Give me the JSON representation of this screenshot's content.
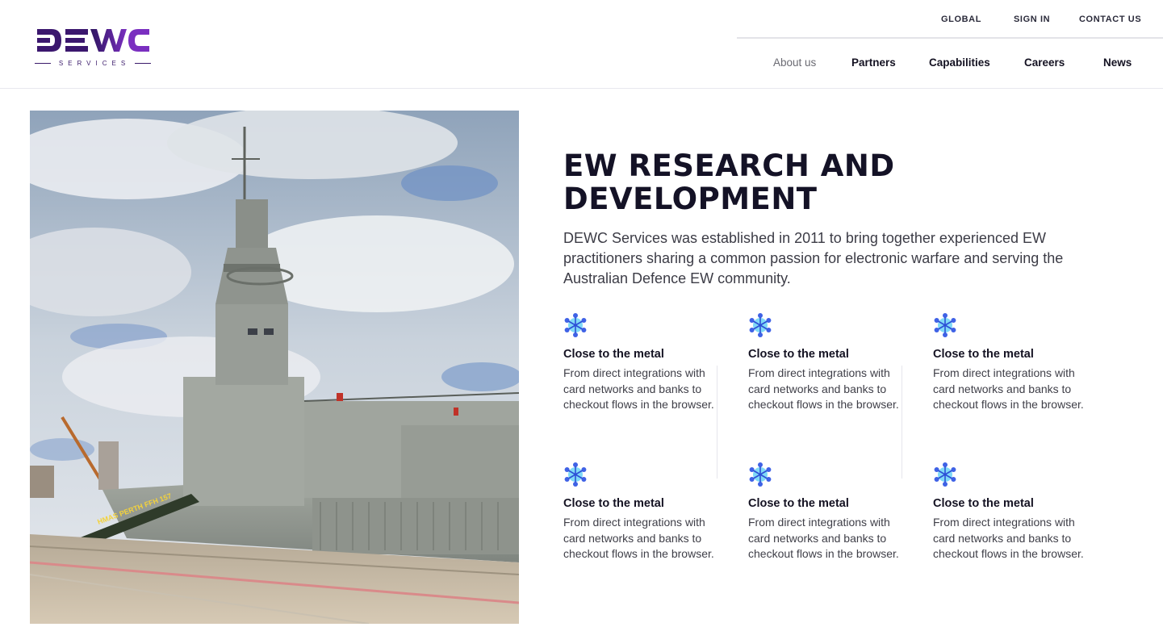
{
  "brand": {
    "logo_text": "DEWC",
    "logo_sub": "SERVICES",
    "color_primary": "#3b176e",
    "color_accent": "#7a2fc0"
  },
  "utility_nav": {
    "global": "GLOBAL",
    "sign_in": "SIGN IN",
    "contact": "CONTACT US"
  },
  "main_nav": {
    "about": "About us",
    "partners": "Partners",
    "capabilities": "Capabilities",
    "careers": "Careers",
    "news": "News"
  },
  "hero": {
    "title_line1": "EW RESEARCH AND",
    "title_line2": "DEVELOPMENT",
    "intro": "DEWC Services was established in 2011 to bring together experienced EW practitioners sharing a common passion for electronic warfare and serving the Australian Defence EW community.",
    "image_alt_icon": "warship-photo"
  },
  "features": [
    {
      "title": "Close to the metal",
      "body": "From direct integrations with card networks and banks to checkout flows in the browser."
    },
    {
      "title": "Close to the metal",
      "body": "From direct integrations with card networks and banks to checkout flows in the browser."
    },
    {
      "title": "Close to the metal",
      "body": "From direct integrations with card networks and banks to checkout flows in the browser."
    },
    {
      "title": "Close to the metal",
      "body": "From direct integrations with card networks and banks to checkout flows in the browser."
    },
    {
      "title": "Close to the metal",
      "body": "From direct integrations with card networks and banks to checkout flows in the browser."
    },
    {
      "title": "Close to the metal",
      "body": "From direct integrations with card networks and banks to checkout flows in the browser."
    }
  ],
  "icons": {
    "feature": "snowflake-network-icon"
  },
  "ship_hull_text": "HMAS PERTH FFH 157"
}
